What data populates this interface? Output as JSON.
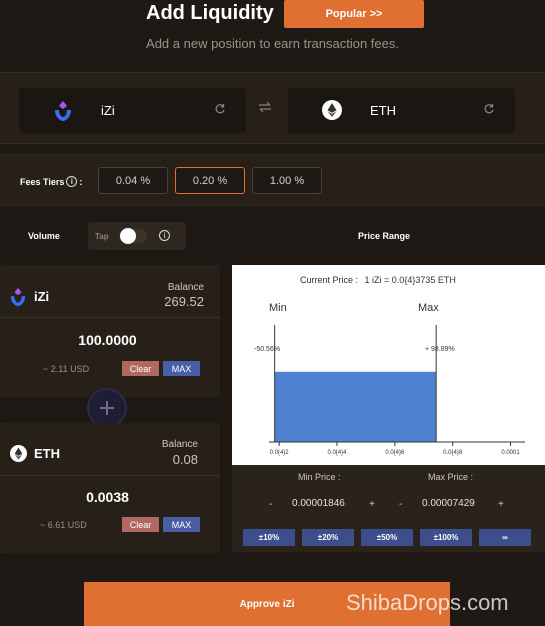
{
  "header": {
    "title": "Add Liquidity",
    "popular_label": "Popular >>",
    "subtitle": "Add a new position to earn transaction fees."
  },
  "pair": {
    "token_a": "iZi",
    "token_b": "ETH",
    "swap_icon": "swap-arrows-icon",
    "refresh_icon": "refresh-icon"
  },
  "fees": {
    "label": "Fees Tiers",
    "colon": ":",
    "tiers": [
      "0.04 %",
      "0.20 %",
      "1.00 %"
    ],
    "selected": "0.20 %"
  },
  "volume": {
    "label": "Volume",
    "tap_label": "Tap",
    "toggle_on": false
  },
  "price_range_label": "Price Range",
  "deposit_a": {
    "token": "iZi",
    "balance_label": "Balance",
    "balance": "269.52",
    "amount": "100.0000",
    "usd": "~ 2.11 USD",
    "clear_label": "Clear",
    "max_label": "MAX"
  },
  "deposit_b": {
    "token": "ETH",
    "balance_label": "Balance",
    "balance": "0.08",
    "amount": "0.0038",
    "usd": "~ 6.61 USD",
    "clear_label": "Clear",
    "max_label": "MAX"
  },
  "price": {
    "current_label": "Current Price :",
    "current_value": "1 iZi = 0.0{4}3735 ETH",
    "min_label": "Min",
    "max_label": "Max",
    "min_pct": "-50.56%",
    "max_pct": "+ 98.89%",
    "min_price_label": "Min Price :",
    "max_price_label": "Max Price :",
    "min_price": "0.00001846",
    "max_price": "0.00007429",
    "minus": "-",
    "plus": "+"
  },
  "chart_data": {
    "type": "area",
    "x_ticks": [
      "0.0{4}2",
      "0.0{4}4",
      "0.0{4}6",
      "0.0{4}8",
      "0.0001"
    ],
    "x_tick_values": [
      2e-05,
      4e-05,
      6e-05,
      8e-05,
      0.0001
    ],
    "range_min": 1.846e-05,
    "range_max": 7.429e-05,
    "xlim": [
      1.65e-05,
      0.000105
    ],
    "fill_level": 0.6,
    "fill_color": "#4f83d1"
  },
  "range_buttons": [
    "±10%",
    "±20%",
    "±50%",
    "±100%",
    "∞"
  ],
  "approve_label": "Approve iZi",
  "watermark": "ShibaDrops.com",
  "colors": {
    "accent": "#e07032",
    "blue": "#4a5ea8",
    "clear": "#b06860"
  }
}
